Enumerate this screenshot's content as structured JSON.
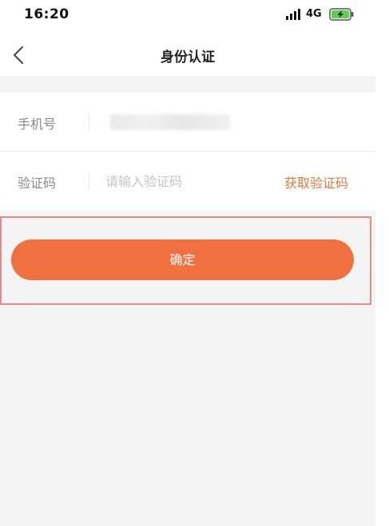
{
  "status_bar": {
    "time": "16:20",
    "network": "4G",
    "signal_icon": "signal-bars-icon",
    "battery_icon": "battery-charging-icon"
  },
  "nav": {
    "back_icon": "chevron-left-icon",
    "title": "身份认证"
  },
  "form": {
    "phone": {
      "label": "手机号",
      "value_obscured": true
    },
    "code": {
      "label": "验证码",
      "placeholder": "请输入验证码",
      "value": ""
    },
    "get_code_label": "获取验证码"
  },
  "confirm_button": {
    "label": "确定"
  },
  "colors": {
    "accent": "#f07040",
    "link": "#e07a3c",
    "highlight_border": "#e88a8a",
    "page_background": "#f4f4f4"
  }
}
